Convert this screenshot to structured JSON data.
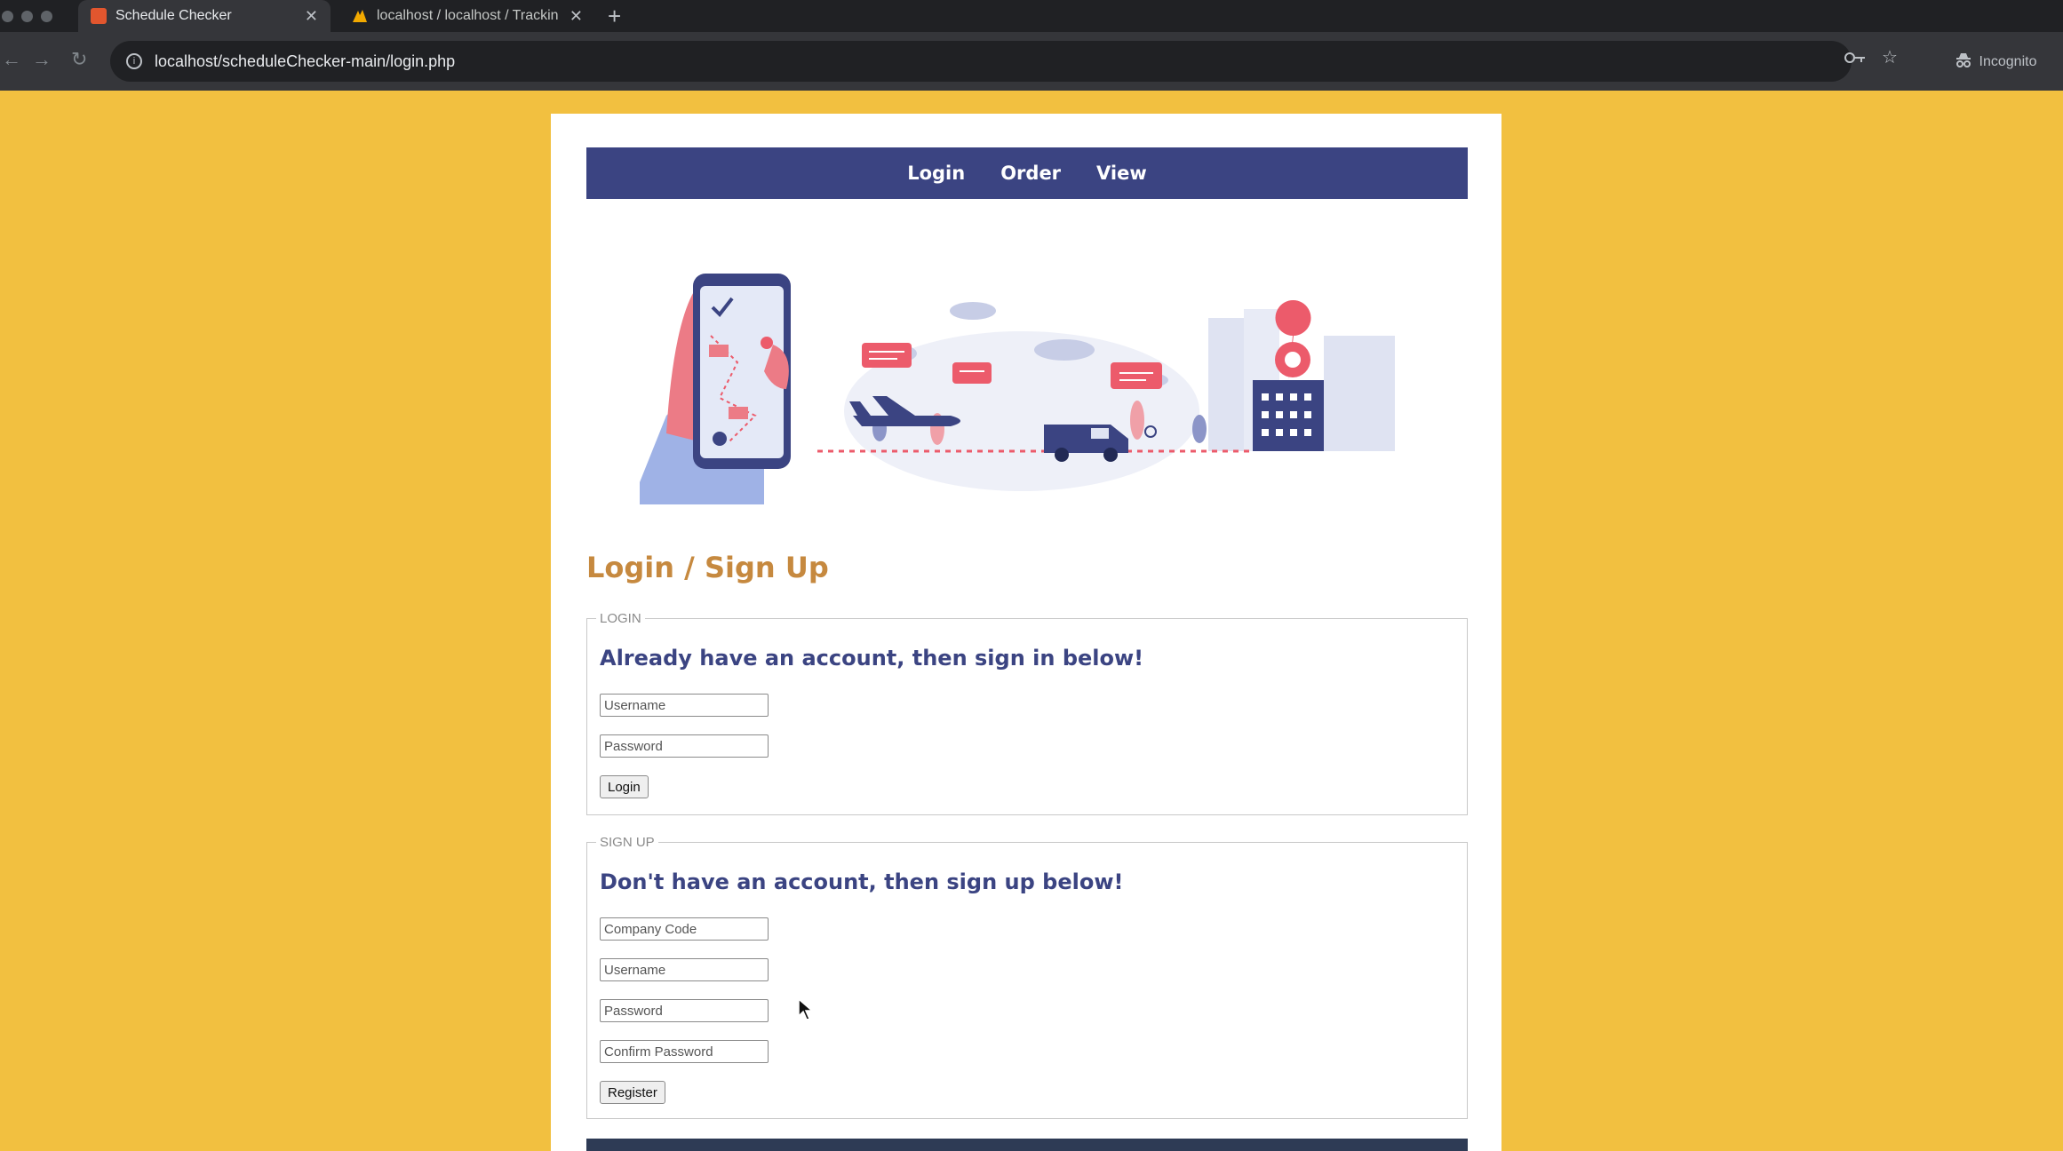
{
  "browser": {
    "tabs": [
      {
        "title": "Schedule Checker",
        "active": true,
        "favicon_color": "#e2562e"
      },
      {
        "title": "localhost / localhost / Trackin",
        "active": false,
        "favicon_color": "#f2a900"
      }
    ],
    "new_tab_symbol": "+",
    "url": "localhost/scheduleChecker-main/login.php",
    "incognito_label": "Incognito",
    "icons": [
      "back-icon",
      "forward-icon",
      "reload-icon",
      "site-info-icon",
      "key-icon",
      "star-icon",
      "incognito-icon"
    ]
  },
  "colors": {
    "background": "#f2c040",
    "nav": "#3b4482",
    "heading": "#c6893f",
    "section_title": "#3b4482",
    "footer": "#2e3b55"
  },
  "nav": {
    "items": [
      "Login",
      "Order",
      "View"
    ]
  },
  "page": {
    "heading": "Login / Sign Up"
  },
  "login": {
    "legend": "LOGIN",
    "title": "Already have an account, then sign in below!",
    "username_placeholder": "Username",
    "password_placeholder": "Password",
    "button": "Login"
  },
  "signup": {
    "legend": "SIGN UP",
    "title": "Don't have an account, then sign up below!",
    "company_code_placeholder": "Company Code",
    "username_placeholder": "Username",
    "password_placeholder": "Password",
    "confirm_password_placeholder": "Confirm Password",
    "button": "Register"
  }
}
